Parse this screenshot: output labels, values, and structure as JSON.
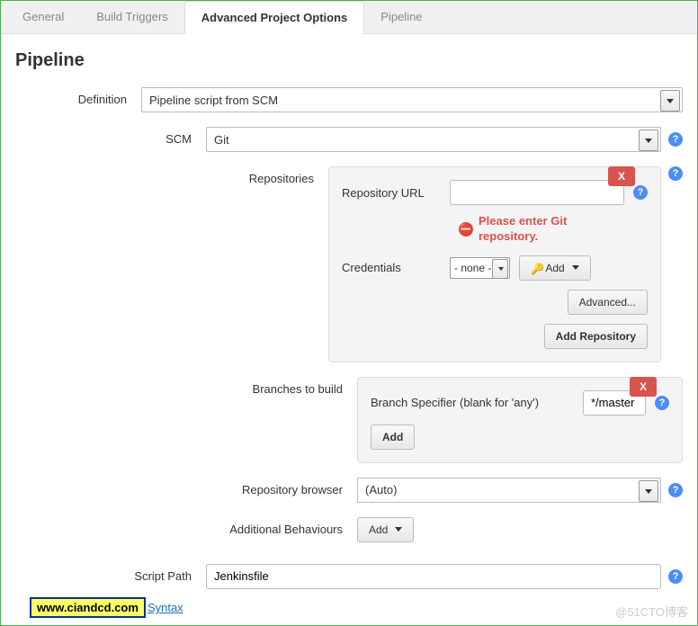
{
  "tabs": {
    "general": "General",
    "build_triggers": "Build Triggers",
    "advanced": "Advanced Project Options",
    "pipeline": "Pipeline"
  },
  "heading": "Pipeline",
  "labels": {
    "definition": "Definition",
    "scm": "SCM",
    "repositories": "Repositories",
    "repository_url": "Repository URL",
    "credentials": "Credentials",
    "branches": "Branches to build",
    "branch_specifier": "Branch Specifier (blank for 'any')",
    "repo_browser": "Repository browser",
    "additional_behaviours": "Additional Behaviours",
    "script_path": "Script Path"
  },
  "values": {
    "definition": "Pipeline script from SCM",
    "scm": "Git",
    "credentials": "- none -",
    "branch_specifier": "*/master",
    "repo_browser": "(Auto)",
    "script_path": "Jenkinsfile"
  },
  "buttons": {
    "close": "X",
    "add_cred": "Add",
    "advanced": "Advanced...",
    "add_repository": "Add Repository",
    "add": "Add",
    "add_behaviour": "Add"
  },
  "error": "Please enter Git repository.",
  "footer": {
    "brand": "www.ciandcd.com",
    "syntax": "Syntax",
    "watermark": "@51CTO博客"
  }
}
